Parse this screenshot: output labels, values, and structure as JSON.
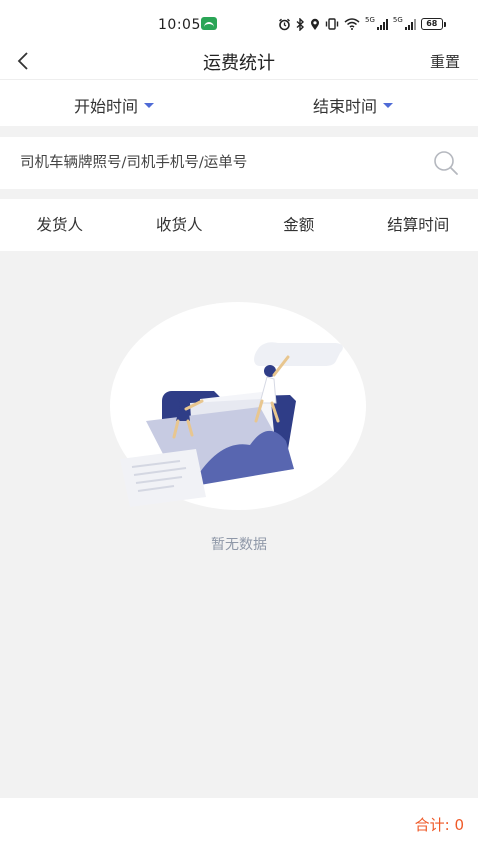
{
  "status_bar": {
    "time": "10:05",
    "network_label_1": "5G",
    "network_label_2": "5G",
    "battery": "68",
    "icons": [
      "alarm-icon",
      "bluetooth-icon",
      "location-icon",
      "vibrate-icon",
      "wifi-icon",
      "signal-icon",
      "signal-icon",
      "battery-icon"
    ]
  },
  "nav": {
    "title": "运费统计",
    "reset_label": "重置",
    "back_icon": "back-arrow-icon"
  },
  "filters": {
    "start_label": "开始时间",
    "end_label": "结束时间",
    "caret_color": "#4f6bd6"
  },
  "search": {
    "placeholder": "司机车辆牌照号/司机手机号/运单号",
    "value": "",
    "icon": "search-icon"
  },
  "table": {
    "columns": [
      "发货人",
      "收货人",
      "金额",
      "结算时间"
    ],
    "rows": []
  },
  "empty_state": {
    "text": "暂无数据",
    "illustration": "empty-folder-illustration"
  },
  "footer": {
    "total_label": "合计: ",
    "total_value": "0",
    "accent_color": "#ef5a28"
  }
}
